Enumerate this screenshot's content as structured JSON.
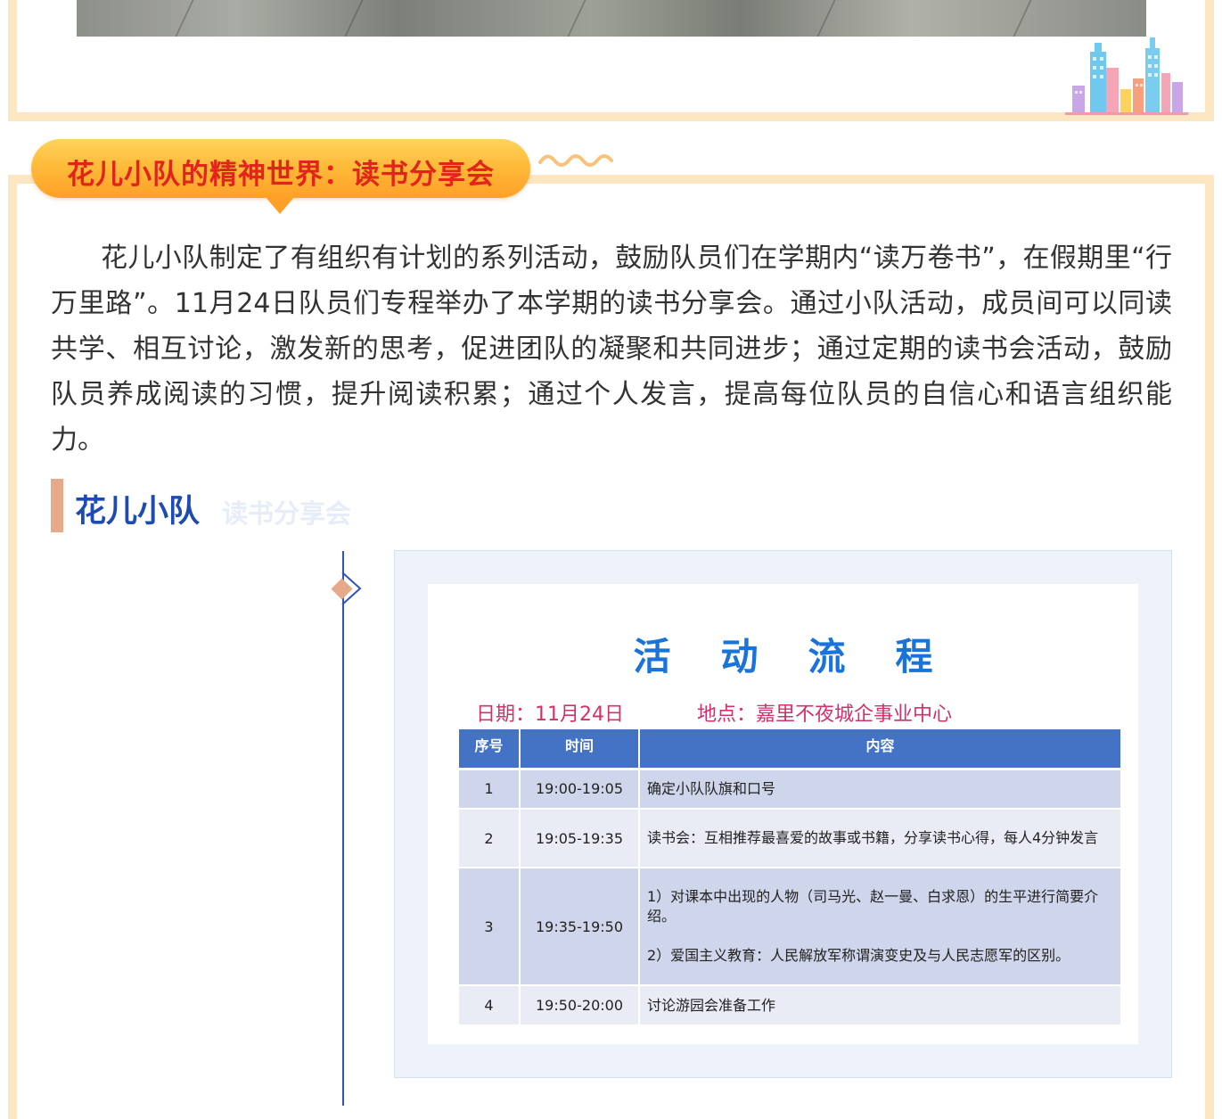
{
  "section": {
    "title": "花儿小队的精神世界：读书分享会",
    "intro": "花儿小队制定了有组织有计划的系列活动，鼓励队员们在学期内“读万卷书”，在假期里“行万里路”。11月24日队员们专程举办了本学期的读书分享会。通过小队活动，成员间可以同读共学、相互讨论，激发新的思考，促进团队的凝聚和共同进步；通过定期的读书会活动，鼓励队员养成阅读的习惯，提升阅读积累；通过个人发言，提高每位队员的自信心和语言组织能力。",
    "sub_heading": "花儿小队",
    "sub_heading_ghost": "读书分享会"
  },
  "schedule": {
    "title": "活动流程",
    "date": "日期：11月24日",
    "place": "地点：嘉里不夜城企事业中心",
    "headers": [
      "序号",
      "时间",
      "内容"
    ],
    "rows": [
      {
        "no": "1",
        "time": "19:00-19:05",
        "content": "确定小队队旗和口号"
      },
      {
        "no": "2",
        "time": "19:05-19:35",
        "content": "读书会：互相推荐最喜爱的故事或书籍，分享读书心得，每人4分钟发言"
      },
      {
        "no": "3",
        "time": "19:35-19:50",
        "content": "1）对课本中出现的人物（司马光、赵一曼、白求恩）的生平进行简要介绍。",
        "content2": "2）爱国主义教育：人民解放军称谓演变史及与人民志愿军的区别。"
      },
      {
        "no": "4",
        "time": "19:50-20:00",
        "content": "讨论游园会准备工作"
      }
    ]
  },
  "colors": {
    "frame": "#fde7c3",
    "banner": "#ffa027",
    "banner_text": "#e1251b",
    "heading_blue": "#1d4bb2",
    "accent_pink": "#e6a98a",
    "table_header": "#4472c4",
    "flow_title": "#1a73d9",
    "meta_text": "#d2306b"
  },
  "icons": [
    "city-skyline-icon",
    "wave-decoration-icon",
    "timeline-diamond-icon"
  ]
}
